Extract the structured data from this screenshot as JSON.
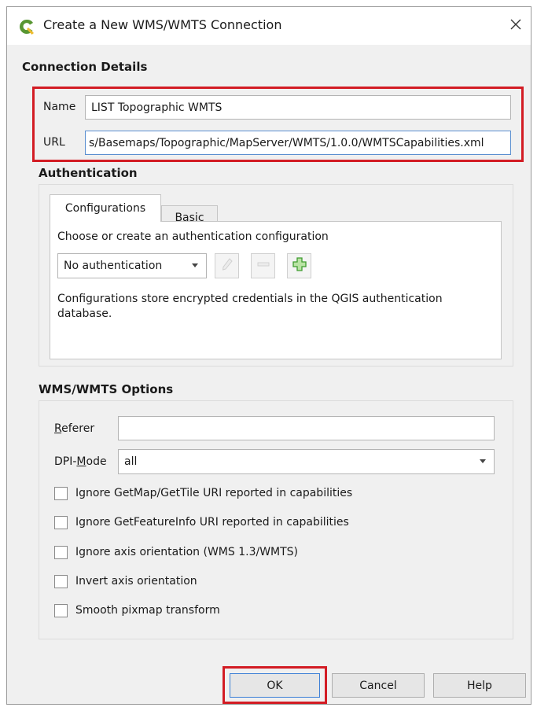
{
  "window": {
    "title": "Create a New WMS/WMTS Connection",
    "app_icon": "qgis-logo-icon",
    "close_icon": "close-icon"
  },
  "connection_details": {
    "header": "Connection Details",
    "name_label": "Name",
    "name_value": "LIST Topographic WMTS",
    "url_label": "URL",
    "url_value": "s/Basemaps/Topographic/MapServer/WMTS/1.0.0/WMTSCapabilities.xml"
  },
  "authentication": {
    "header": "Authentication",
    "tabs": [
      {
        "label": "Configurations",
        "active": true
      },
      {
        "label": "Basic",
        "active": false
      }
    ],
    "prompt": "Choose or create an authentication configuration",
    "combo_value": "No authentication",
    "edit_icon": "pencil-icon",
    "remove_icon": "remove-icon",
    "add_icon": "add-plus-icon",
    "info_line1": "Configurations store encrypted credentials in the QGIS authentication",
    "info_line2": "database."
  },
  "options": {
    "header": "WMS/WMTS Options",
    "referer_label_accel": "R",
    "referer_label_rest": "eferer",
    "referer_value": "",
    "dpi_label_pre": "DPI-",
    "dpi_label_accel": "M",
    "dpi_label_post": "ode",
    "dpi_value": "all",
    "checkboxes": [
      {
        "label": "Ignore GetMap/GetTile URI reported in capabilities",
        "checked": false
      },
      {
        "label": "Ignore GetFeatureInfo URI reported in capabilities",
        "checked": false
      },
      {
        "label": "Ignore axis orientation (WMS 1.3/WMTS)",
        "checked": false
      },
      {
        "label": "Invert axis orientation",
        "checked": false
      },
      {
        "label": "Smooth pixmap transform",
        "checked": false
      }
    ]
  },
  "buttons": {
    "ok": "OK",
    "cancel": "Cancel",
    "help": "Help"
  },
  "colors": {
    "highlight": "#d31c24",
    "qgis_green": "#589632",
    "qgis_yellow": "#eebc2f"
  }
}
